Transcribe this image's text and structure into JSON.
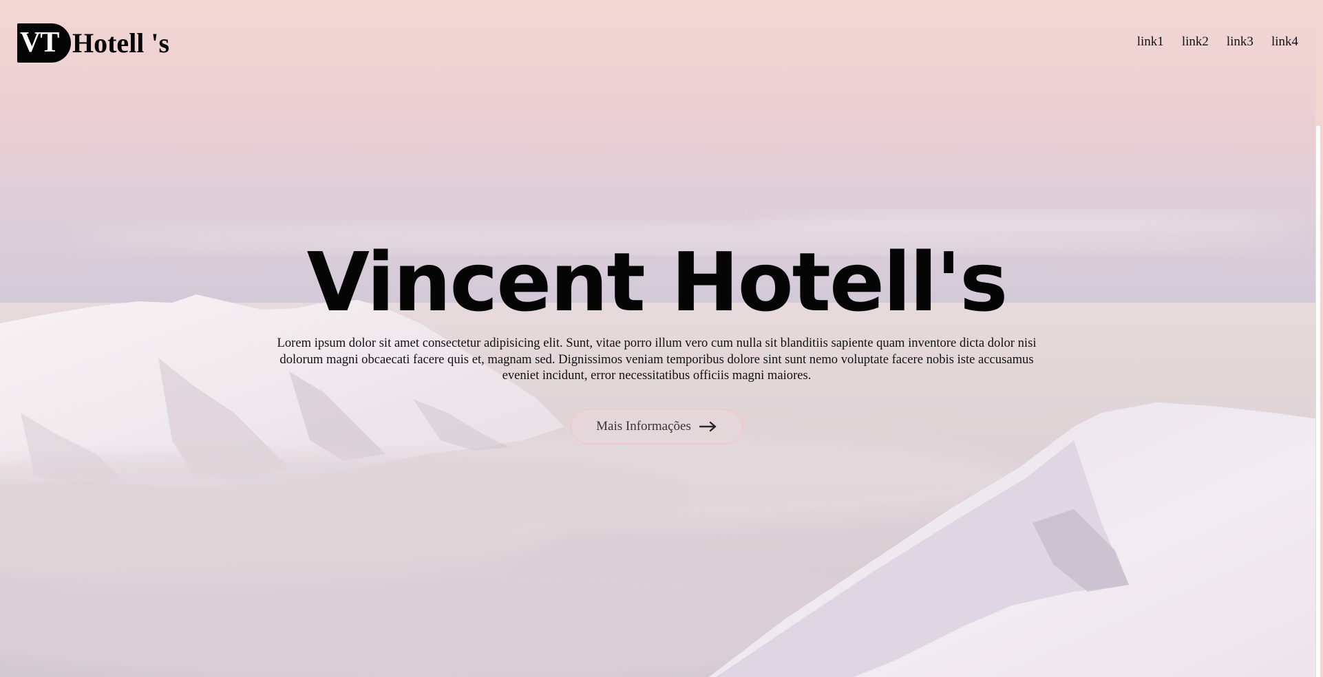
{
  "header": {
    "logo_badge": "VT",
    "logo_text": "Hotell 's",
    "nav": [
      "link1",
      "link2",
      "link3",
      "link4"
    ]
  },
  "hero": {
    "title": "Vincent Hotell's",
    "description": "Lorem ipsum dolor sit amet consectetur adipisicing elit. Sunt, vitae porro illum vero cum nulla sit blanditiis sapiente quam inventore dicta dolor nisi dolorum magni obcaecati facere quis et, magnam sed. Dignissimos veniam temporibus dolore sint sunt nemo voluptate facere nobis iste accusamus eveniet incidunt, error necessitatibus officiis magni maiores.",
    "button_label": "Mais Informações",
    "button_icon": "arrow-right-icon",
    "background": "snowy-mountains-above-clouds"
  },
  "colors": {
    "sky_top": "#f2d5d1",
    "sky_mid": "#d9cbd6",
    "clouds": "#d8d0d6",
    "snow": "#f3eff3",
    "text": "#050505",
    "button_border": "#f0c8c8"
  }
}
